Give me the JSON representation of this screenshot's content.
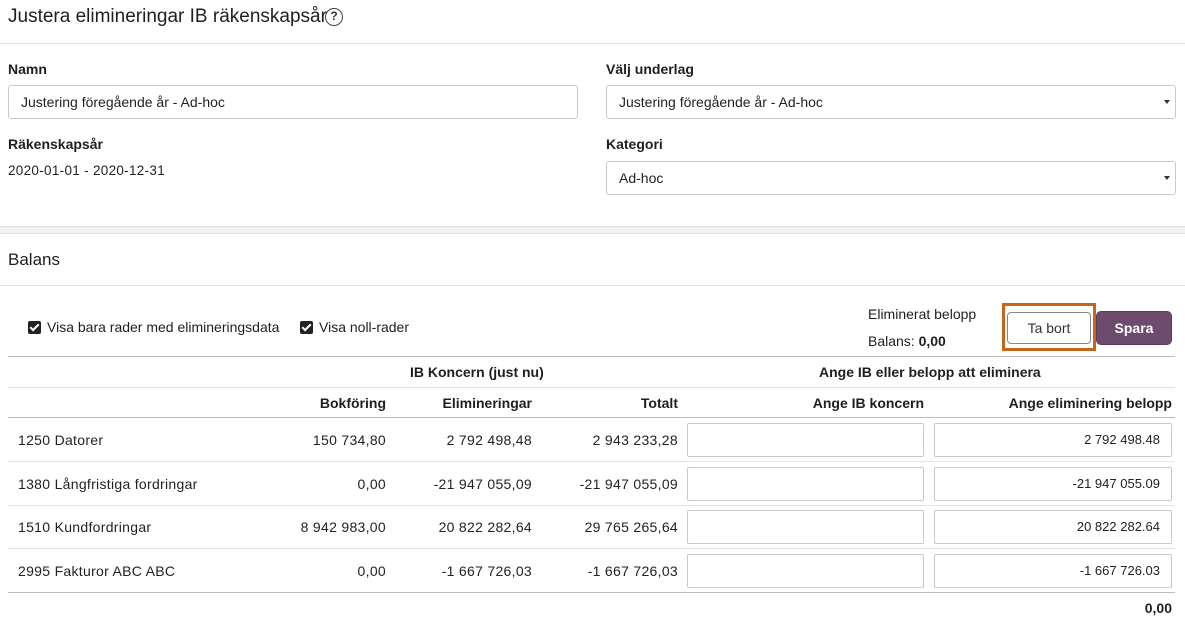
{
  "header": {
    "title": "Justera elimineringar IB räkenskapsår",
    "help_symbol": "?"
  },
  "form": {
    "namn_label": "Namn",
    "namn_value": "Justering föregående år - Ad-hoc",
    "rakenskapsar_label": "Räkenskapsår",
    "rakenskapsar_value": "2020-01-01 - 2020-12-31",
    "underlag_label": "Välj underlag",
    "underlag_value": "Justering föregående år - Ad-hoc",
    "kategori_label": "Kategori",
    "kategori_value": "Ad-hoc"
  },
  "balans": {
    "title": "Balans",
    "filter_only_elim": "Visa bara rader med elimineringsdata",
    "filter_zero_rows": "Visa noll-rader",
    "eliminerat_label": "Eliminerat belopp",
    "balans_label": "Balans:",
    "balans_value": "0,00",
    "btn_ta_bort": "Ta bort",
    "btn_spara": "Spara"
  },
  "table": {
    "group_ib": "IB Koncern (just nu)",
    "group_ange": "Ange IB eller belopp att eliminera",
    "col_bokforing": "Bokföring",
    "col_elimineringar": "Elimineringar",
    "col_totalt": "Totalt",
    "col_ange_ib": "Ange IB koncern",
    "col_ange_elim": "Ange eliminering belopp",
    "rows": [
      {
        "account": "1250",
        "name": "Datorer",
        "bokforing": "150 734,80",
        "elimineringar": "2 792 498,48",
        "totalt": "2 943 233,28",
        "ange_ib": "",
        "ange_elim": "2 792 498.48"
      },
      {
        "account": "1380",
        "name": "Långfristiga fordringar",
        "bokforing": "0,00",
        "elimineringar": "-21 947 055,09",
        "totalt": "-21 947 055,09",
        "ange_ib": "",
        "ange_elim": "-21 947 055.09"
      },
      {
        "account": "1510",
        "name": "Kundfordringar",
        "bokforing": "8 942 983,00",
        "elimineringar": "20 822 282,64",
        "totalt": "29 765 265,64",
        "ange_ib": "",
        "ange_elim": "20 822 282.64"
      },
      {
        "account": "2995",
        "name": "Fakturor ABC ABC",
        "bokforing": "0,00",
        "elimineringar": "-1 667 726,03",
        "totalt": "-1 667 726,03",
        "ange_ib": "",
        "ange_elim": "-1 667 726.03"
      }
    ],
    "footer_total": "0,00"
  },
  "icons": {
    "help": "question-circle-icon",
    "checkbox": "checkbox-checked-icon",
    "caret": "caret-down-icon"
  },
  "colors": {
    "primary_button": "#6d4b6e",
    "highlight": "#c8651b"
  }
}
